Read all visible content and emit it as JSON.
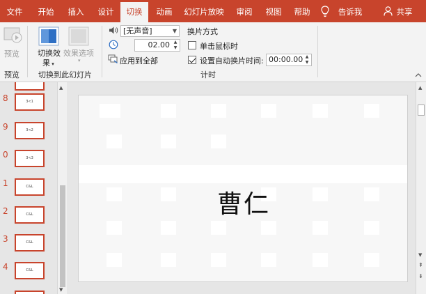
{
  "tabs": [
    {
      "label": "文件",
      "active": false
    },
    {
      "label": "开始",
      "active": false
    },
    {
      "label": "插入",
      "active": false
    },
    {
      "label": "设计",
      "active": false
    },
    {
      "label": "切换",
      "active": true
    },
    {
      "label": "动画",
      "active": false
    },
    {
      "label": "幻灯片放映",
      "active": false
    },
    {
      "label": "审阅",
      "active": false
    },
    {
      "label": "视图",
      "active": false
    },
    {
      "label": "帮助",
      "active": false
    }
  ],
  "tell_me": "告诉我",
  "share": "共享",
  "ribbon": {
    "preview_btn": "预览",
    "preview_group": "预览",
    "transition_effect_line1": "切换效",
    "transition_effect_line2": "果",
    "effect_options": "效果选项",
    "transition_group": "切换到此幻灯片",
    "sound_value": "[无声音]",
    "duration_value": "02.00",
    "apply_all": "应用到全部",
    "advance_heading": "换片方式",
    "on_click": "单击鼠标时",
    "on_click_checked": false,
    "after_time": "设置自动换片时间:",
    "after_time_checked": true,
    "after_time_value": "00:00.00",
    "timing_group": "计时"
  },
  "thumbnails": [
    {
      "num": "8",
      "text": "3<1"
    },
    {
      "num": "9",
      "text": "3<2"
    },
    {
      "num": "0",
      "text": "3<3"
    },
    {
      "num": "1",
      "text": "C&L"
    },
    {
      "num": "2",
      "text": "C&L"
    },
    {
      "num": "3",
      "text": "C&L"
    },
    {
      "num": "4",
      "text": "C&L"
    }
  ],
  "slide": {
    "title": "曹仁"
  },
  "colors": {
    "accent": "#c8442c",
    "ribbon_bg": "#f3f3f3",
    "workspace_bg": "#e6e6e6"
  }
}
